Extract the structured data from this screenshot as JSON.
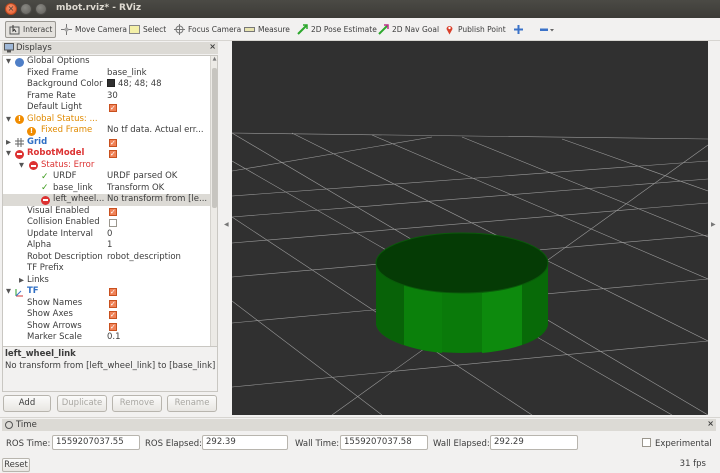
{
  "window": {
    "title": "mbot.rviz* - RViz"
  },
  "toolbar": {
    "interact": "Interact",
    "move_camera": "Move Camera",
    "select": "Select",
    "focus_camera": "Focus Camera",
    "measure": "Measure",
    "pose_estimate": "2D Pose Estimate",
    "nav_goal": "2D Nav Goal",
    "publish_point": "Publish Point"
  },
  "displays": {
    "title": "Displays",
    "rows": [
      {
        "name": "Global Options",
        "value": ""
      },
      {
        "name": "Fixed Frame",
        "value": "base_link"
      },
      {
        "name": "Background Color",
        "value": "48; 48; 48"
      },
      {
        "name": "Frame Rate",
        "value": "30"
      },
      {
        "name": "Default Light",
        "value": ""
      },
      {
        "name": "Global Status: ...",
        "value": ""
      },
      {
        "name": "Fixed Frame",
        "value": "No tf data.  Actual err..."
      },
      {
        "name": "Grid",
        "value": ""
      },
      {
        "name": "RobotModel",
        "value": ""
      },
      {
        "name": "Status: Error",
        "value": ""
      },
      {
        "name": "URDF",
        "value": "URDF parsed OK"
      },
      {
        "name": "base_link",
        "value": "Transform OK"
      },
      {
        "name": "left_wheel...",
        "value": "No transform from [le..."
      },
      {
        "name": "Visual Enabled",
        "value": ""
      },
      {
        "name": "Collision Enabled",
        "value": ""
      },
      {
        "name": "Update Interval",
        "value": "0"
      },
      {
        "name": "Alpha",
        "value": "1"
      },
      {
        "name": "Robot Description",
        "value": "robot_description"
      },
      {
        "name": "TF Prefix",
        "value": ""
      },
      {
        "name": "Links",
        "value": ""
      },
      {
        "name": "TF",
        "value": ""
      },
      {
        "name": "Show Names",
        "value": ""
      },
      {
        "name": "Show Axes",
        "value": ""
      },
      {
        "name": "Show Arrows",
        "value": ""
      },
      {
        "name": "Marker Scale",
        "value": "0.1"
      }
    ],
    "description_title": "left_wheel_link",
    "description_text": "No transform from [left_wheel_link] to [base_link]",
    "buttons": {
      "add": "Add",
      "duplicate": "Duplicate",
      "remove": "Remove",
      "rename": "Rename"
    }
  },
  "time": {
    "title": "Time",
    "ros_time_label": "ROS Time:",
    "ros_time": "1559207037.55",
    "ros_elapsed_label": "ROS Elapsed:",
    "ros_elapsed": "292.39",
    "wall_time_label": "Wall Time:",
    "wall_time": "1559207037.58",
    "wall_elapsed_label": "Wall Elapsed:",
    "wall_elapsed": "292.29",
    "experimental": "Experimental",
    "reset": "Reset",
    "fps": "31 fps"
  },
  "colors": {
    "viewport_bg": "#303030",
    "model": "#0a6e0a",
    "error": "#dc3232",
    "warning": "#f08c00",
    "link_blue": "#2f6fc4"
  }
}
